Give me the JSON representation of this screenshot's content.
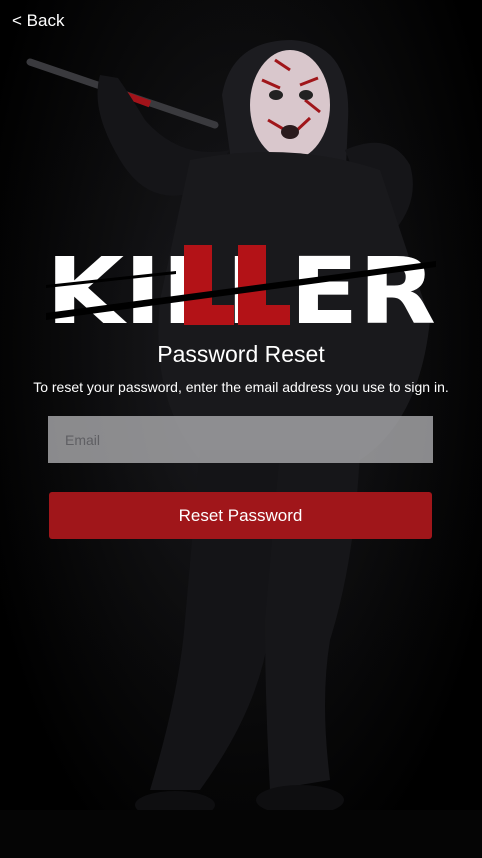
{
  "nav": {
    "back_label": "< Back"
  },
  "brand": {
    "logo_text": "KILLER",
    "logo_primary_color": "#ffffff",
    "logo_accent_color": "#b31217"
  },
  "page": {
    "title": "Password Reset",
    "instructions": "To reset your password, enter the email address you use to sign in."
  },
  "form": {
    "email_value": "",
    "email_placeholder": "Email",
    "submit_label": "Reset Password"
  },
  "colors": {
    "background": "#000000",
    "button": "#a0161a",
    "input": "#afafb2"
  }
}
